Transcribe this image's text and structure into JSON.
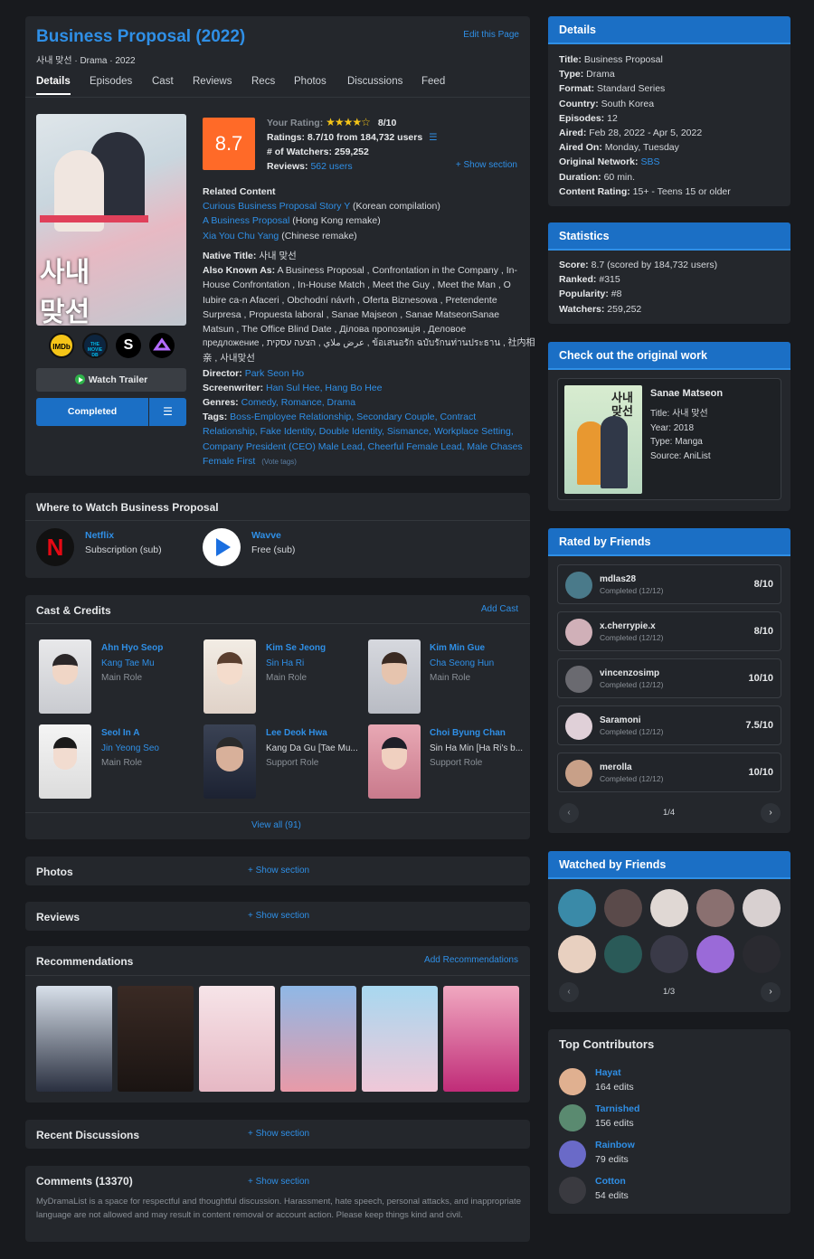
{
  "title": "Business Proposal (2022)",
  "edit_link": "Edit this Page",
  "subtitle": "사내 맞선 · Drama · 2022",
  "tabs": [
    "Details",
    "Episodes",
    "Cast",
    "Reviews",
    "Recs",
    "Photos",
    "Discussions",
    "Feed"
  ],
  "rating": {
    "label": "Your Rating:",
    "value": "8/10",
    "score": "8.7",
    "ratings_label": "Ratings:",
    "ratings_value": "8.7/10 from 184,732 users",
    "watchers_label": "# of Watchers:",
    "watchers_value": "259,252",
    "reviews_label": "Reviews:",
    "reviews_value": "562 users",
    "show_section": "+ Show section"
  },
  "streaming_icons": [
    "IMDb",
    "THE MOVIE DB",
    "S",
    ""
  ],
  "watch_trailer": "Watch Trailer",
  "status_button": "Completed",
  "related": {
    "heading": "Related Content",
    "items": [
      {
        "link": "Curious Business Proposal Story Y",
        "note": "(Korean compilation)"
      },
      {
        "link": "A Business Proposal",
        "note": "(Hong Kong remake)"
      },
      {
        "link": "Xia You Chu Yang",
        "note": "(Chinese remake)"
      }
    ]
  },
  "native_title": {
    "label": "Native Title:",
    "value": "사내 맞선"
  },
  "aka": {
    "label": "Also Known As:",
    "lines": [
      "A Business Proposal , Confrontation in the Company , In-",
      "House Confrontation , In-House Match , Meet the Guy , Meet the Man , O",
      "Iubire ca-n Afaceri , Obchodní návrh , Oferta Biznesowa , Pretendente",
      "Surpresa , Propuesta laboral , Sanae Majseon , Sanae MatseonSanae",
      "Matsun , The Office Blind Date , Ділова пропозиція , Деловое",
      "предложение , عرض ملاي , הצעה עסקית , ข้อเสนอรัก ฉบับรักนท่านประธาน , 社内相",
      "亲 , 사내맞선"
    ]
  },
  "director": {
    "label": "Director:",
    "value": "Park Seon Ho"
  },
  "screenwriter": {
    "label": "Screenwriter:",
    "value": "Han Sul Hee, Hang Bo Hee"
  },
  "genres": {
    "label": "Genres:",
    "value": "Comedy, Romance, Drama"
  },
  "tags": {
    "label": "Tags:",
    "lines": [
      "Boss-Employee Relationship, Secondary Couple, Contract",
      "Relationship, Fake Identity, Double Identity, Sismance, Workplace Setting,",
      "Company President (CEO) Male Lead, Cheerful Female Lead, Male Chases",
      "Female First"
    ],
    "vote": "(Vote tags)"
  },
  "where": {
    "title": "Where to Watch Business Proposal",
    "items": [
      {
        "name": "Netflix",
        "type": "Subscription (sub)"
      },
      {
        "name": "Wavve",
        "type": "Free (sub)"
      }
    ]
  },
  "cast": {
    "title": "Cast & Credits",
    "add": "Add Cast",
    "view_all": "View all (91)",
    "items": [
      {
        "actor": "Ahn Hyo Seop",
        "role_name": "Kang Tae Mu",
        "role": "Main Role"
      },
      {
        "actor": "Kim Se Jeong",
        "role_name": "Sin Ha Ri",
        "role": "Main Role"
      },
      {
        "actor": "Kim Min Gue",
        "role_name": "Cha Seong Hun",
        "role": "Main Role"
      },
      {
        "actor": "Seol In A",
        "role_name": "Jin Yeong Seo",
        "role": "Main Role"
      },
      {
        "actor": "Lee Deok Hwa",
        "role_name": "Kang Da Gu [Tae Mu...",
        "role": "Support Role"
      },
      {
        "actor": "Choi Byung Chan",
        "role_name": "Sin Ha Min [Ha Ri's b...",
        "role": "Support Role"
      }
    ]
  },
  "photos": {
    "title": "Photos",
    "show": "+ Show section"
  },
  "reviews": {
    "title": "Reviews",
    "show": "+ Show section"
  },
  "recs": {
    "title": "Recommendations",
    "add": "Add Recommendations"
  },
  "discussions": {
    "title": "Recent Discussions",
    "show": "+ Show section"
  },
  "comments": {
    "title": "Comments (13370)",
    "show": "+ Show section",
    "notice": "MyDramaList is a space for respectful and thoughtful discussion. Harassment, hate speech, personal attacks, and inappropriate language are not allowed and may result in content removal or account action. Please keep things kind and civil."
  },
  "details": {
    "title": "Details",
    "rows": [
      [
        "Title:",
        "Business Proposal"
      ],
      [
        "Type:",
        "Drama"
      ],
      [
        "Format:",
        "Standard Series"
      ],
      [
        "Country:",
        "South Korea"
      ],
      [
        "Episodes:",
        "12"
      ],
      [
        "Aired:",
        "Feb 28, 2022 - Apr 5, 2022"
      ],
      [
        "Aired On:",
        "Monday, Tuesday"
      ],
      [
        "Original Network:",
        "SBS"
      ],
      [
        "Duration:",
        "60 min."
      ],
      [
        "Content Rating:",
        "15+ - Teens 15 or older"
      ]
    ]
  },
  "statistics": {
    "title": "Statistics",
    "rows": [
      [
        "Score:",
        "8.7 (scored by 184,732 users)"
      ],
      [
        "Ranked:",
        "#315"
      ],
      [
        "Popularity:",
        "#8"
      ],
      [
        "Watchers:",
        "259,252"
      ]
    ]
  },
  "original": {
    "title": "Check out the original work",
    "name": "Sanae Matseon",
    "rows": [
      "Title: 사내 맞선",
      "Year: 2018",
      "Type: Manga",
      "Source: AniList"
    ],
    "cover_text": "사내 맞선"
  },
  "rated": {
    "title": "Rated by Friends",
    "items": [
      {
        "user": "mdlas28",
        "status": "Completed (12/12)",
        "score": "8/10"
      },
      {
        "user": "x.cherrypie.x",
        "status": "Completed (12/12)",
        "score": "8/10"
      },
      {
        "user": "vincenzosimp",
        "status": "Completed (12/12)",
        "score": "10/10"
      },
      {
        "user": "Saramoni",
        "status": "Completed (12/12)",
        "score": "7.5/10"
      },
      {
        "user": "merolla",
        "status": "Completed (12/12)",
        "score": "10/10"
      }
    ],
    "page": "1/4"
  },
  "watched": {
    "title": "Watched by Friends",
    "page": "1/3"
  },
  "contributors": {
    "title": "Top Contributors",
    "items": [
      {
        "name": "Hayat",
        "edits": "164 edits"
      },
      {
        "name": "Tarnished",
        "edits": "156 edits"
      },
      {
        "name": "Rainbow",
        "edits": "79 edits"
      },
      {
        "name": "Cotton",
        "edits": "54 edits"
      }
    ]
  },
  "colors": {
    "accent": "#2f8fe6",
    "header_blue": "#1b6fc5",
    "score_orange": "#ff6a28",
    "star": "#f5c518"
  }
}
